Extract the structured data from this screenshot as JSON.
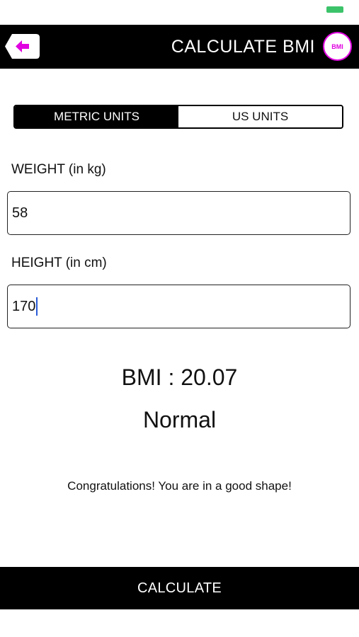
{
  "header": {
    "title": "CALCULATE BMI",
    "badge_label": "BMI",
    "accent_color": "#e000e0"
  },
  "units": {
    "metric_label": "METRIC UNITS",
    "us_label": "US UNITS",
    "selected": "METRIC UNITS"
  },
  "weight": {
    "label": "WEIGHT (in kg)",
    "value": "58"
  },
  "height": {
    "label": "HEIGHT (in cm)",
    "value": "170"
  },
  "result": {
    "bmi_text": "BMI : 20.07",
    "category": "Normal",
    "message": "Congratulations! You are in a good shape!"
  },
  "footer": {
    "calculate_label": "CALCULATE"
  },
  "icons": {
    "back": "back-arrow-icon",
    "battery": "battery-icon"
  }
}
